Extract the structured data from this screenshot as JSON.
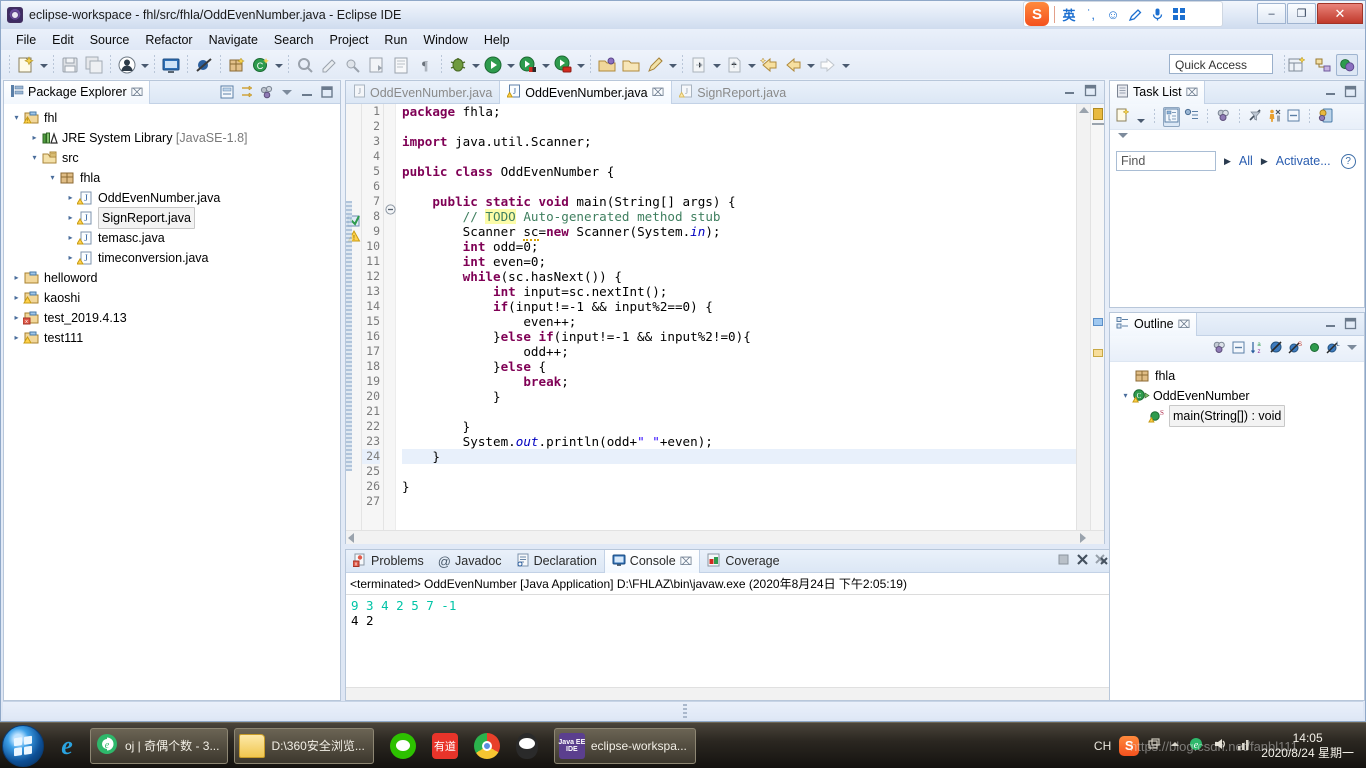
{
  "window": {
    "title": "eclipse-workspace - fhl/src/fhla/OddEvenNumber.java - Eclipse IDE",
    "minimize_label": "–",
    "maximize_label": "❐",
    "close_label": "✕"
  },
  "ime": {
    "logo_label": "S",
    "mode_label": "英",
    "punct_label": "˙,",
    "emoji_label": "☺",
    "pen_label": "✎",
    "mic_label": "ᵔ",
    "apps_label": "apps"
  },
  "menubar": {
    "items": [
      "File",
      "Edit",
      "Source",
      "Refactor",
      "Navigate",
      "Search",
      "Project",
      "Run",
      "Window",
      "Help"
    ]
  },
  "toolbar": {
    "quick_access_placeholder": "Quick Access",
    "quick_access_value": "Quick Access"
  },
  "package_explorer": {
    "title": "Package Explorer",
    "close_label": "⌧",
    "tree": [
      {
        "depth": 0,
        "twist": "▾",
        "icon": "project-warning-icon",
        "label": "fhl",
        "suffix": ""
      },
      {
        "depth": 1,
        "twist": "▸",
        "icon": "jre-library-icon",
        "label": "JRE System Library",
        "suffix": " [JavaSE-1.8]"
      },
      {
        "depth": 1,
        "twist": "▾",
        "icon": "source-folder-icon",
        "label": "src",
        "suffix": ""
      },
      {
        "depth": 2,
        "twist": "▾",
        "icon": "package-icon",
        "label": "fhla",
        "suffix": ""
      },
      {
        "depth": 3,
        "twist": "▸",
        "icon": "java-file-icon",
        "label": "OddEvenNumber.java",
        "suffix": ""
      },
      {
        "depth": 3,
        "twist": "▸",
        "icon": "java-file-icon",
        "label": "SignReport.java",
        "suffix": "",
        "selected": true
      },
      {
        "depth": 3,
        "twist": "▸",
        "icon": "java-file-icon",
        "label": "temasc.java",
        "suffix": ""
      },
      {
        "depth": 3,
        "twist": "▸",
        "icon": "java-file-icon",
        "label": "timeconversion.java",
        "suffix": ""
      },
      {
        "depth": 0,
        "twist": "▸",
        "icon": "project-icon",
        "label": "helloword",
        "suffix": ""
      },
      {
        "depth": 0,
        "twist": "▸",
        "icon": "project-warning-icon",
        "label": "kaoshi",
        "suffix": ""
      },
      {
        "depth": 0,
        "twist": "▸",
        "icon": "project-error-icon",
        "label": "test_2019.4.13",
        "suffix": ""
      },
      {
        "depth": 0,
        "twist": "▸",
        "icon": "project-warning-icon",
        "label": "test111",
        "suffix": ""
      }
    ]
  },
  "editor": {
    "tabs": [
      {
        "label": "OddEvenNumber.java",
        "active": false,
        "closable": false
      },
      {
        "label": "OddEvenNumber.java",
        "active": true,
        "closable": true,
        "close_label": "⌧"
      },
      {
        "label": "SignReport.java",
        "active": false,
        "closable": false
      }
    ],
    "lines": [
      {
        "n": 1,
        "segs": [
          {
            "t": "package",
            "c": "kw"
          },
          {
            "t": " fhla;",
            "c": ""
          }
        ]
      },
      {
        "n": 2,
        "segs": []
      },
      {
        "n": 3,
        "segs": [
          {
            "t": "import",
            "c": "kw"
          },
          {
            "t": " java.util.Scanner;",
            "c": ""
          }
        ]
      },
      {
        "n": 4,
        "segs": []
      },
      {
        "n": 5,
        "segs": [
          {
            "t": "public class",
            "c": "kw"
          },
          {
            "t": " OddEvenNumber {",
            "c": ""
          }
        ]
      },
      {
        "n": 6,
        "segs": []
      },
      {
        "n": 7,
        "segs": [
          {
            "t": "    ",
            "c": ""
          },
          {
            "t": "public static void",
            "c": "kw"
          },
          {
            "t": " main(String[] args) {",
            "c": ""
          }
        ],
        "fold": true
      },
      {
        "n": 8,
        "segs": [
          {
            "t": "        ",
            "c": ""
          },
          {
            "t": "// ",
            "c": "cm"
          },
          {
            "t": "TODO",
            "c": "todo"
          },
          {
            "t": " Auto-generated method stub",
            "c": "cm"
          }
        ],
        "marker": "task"
      },
      {
        "n": 9,
        "segs": [
          {
            "t": "        Scanner ",
            "c": ""
          },
          {
            "t": "sc",
            "c": "warn"
          },
          {
            "t": "=",
            "c": ""
          },
          {
            "t": "new",
            "c": "kw"
          },
          {
            "t": " Scanner(System.",
            "c": ""
          },
          {
            "t": "in",
            "c": "fld"
          },
          {
            "t": ");",
            "c": ""
          }
        ],
        "marker": "warning"
      },
      {
        "n": 10,
        "segs": [
          {
            "t": "        ",
            "c": ""
          },
          {
            "t": "int",
            "c": "kw"
          },
          {
            "t": " odd=0;",
            "c": ""
          }
        ]
      },
      {
        "n": 11,
        "segs": [
          {
            "t": "        ",
            "c": ""
          },
          {
            "t": "int",
            "c": "kw"
          },
          {
            "t": " even=0;",
            "c": ""
          }
        ]
      },
      {
        "n": 12,
        "segs": [
          {
            "t": "        ",
            "c": ""
          },
          {
            "t": "while",
            "c": "kw"
          },
          {
            "t": "(sc.hasNext()) {",
            "c": ""
          }
        ]
      },
      {
        "n": 13,
        "segs": [
          {
            "t": "            ",
            "c": ""
          },
          {
            "t": "int",
            "c": "kw"
          },
          {
            "t": " input=sc.nextInt();",
            "c": ""
          }
        ]
      },
      {
        "n": 14,
        "segs": [
          {
            "t": "            ",
            "c": ""
          },
          {
            "t": "if",
            "c": "kw"
          },
          {
            "t": "(input!=-1 && input%2==0) {",
            "c": ""
          }
        ]
      },
      {
        "n": 15,
        "segs": [
          {
            "t": "                even++;",
            "c": ""
          }
        ]
      },
      {
        "n": 16,
        "segs": [
          {
            "t": "            }",
            "c": ""
          },
          {
            "t": "else if",
            "c": "kw"
          },
          {
            "t": "(input!=-1 && input%2!=0){",
            "c": ""
          }
        ]
      },
      {
        "n": 17,
        "segs": [
          {
            "t": "                odd++;",
            "c": ""
          }
        ]
      },
      {
        "n": 18,
        "segs": [
          {
            "t": "            }",
            "c": ""
          },
          {
            "t": "else",
            "c": "kw"
          },
          {
            "t": " {",
            "c": ""
          }
        ]
      },
      {
        "n": 19,
        "segs": [
          {
            "t": "                ",
            "c": ""
          },
          {
            "t": "break",
            "c": "kw"
          },
          {
            "t": ";",
            "c": ""
          }
        ]
      },
      {
        "n": 20,
        "segs": [
          {
            "t": "            }",
            "c": ""
          }
        ]
      },
      {
        "n": 21,
        "segs": []
      },
      {
        "n": 22,
        "segs": [
          {
            "t": "        }",
            "c": ""
          }
        ]
      },
      {
        "n": 23,
        "segs": [
          {
            "t": "        System.",
            "c": ""
          },
          {
            "t": "out",
            "c": "fld"
          },
          {
            "t": ".println(odd+",
            "c": ""
          },
          {
            "t": "\" \"",
            "c": "str"
          },
          {
            "t": "+even);",
            "c": ""
          }
        ]
      },
      {
        "n": 24,
        "segs": [
          {
            "t": "    }",
            "c": ""
          }
        ],
        "current": true
      },
      {
        "n": 25,
        "segs": []
      },
      {
        "n": 26,
        "segs": [
          {
            "t": "}",
            "c": ""
          }
        ]
      },
      {
        "n": 27,
        "segs": []
      }
    ]
  },
  "console": {
    "tabs": [
      {
        "label": "Problems",
        "icon": "problems-icon",
        "active": false
      },
      {
        "label": "Javadoc",
        "icon": "javadoc-icon",
        "active": false
      },
      {
        "label": "Declaration",
        "icon": "declaration-icon",
        "active": false
      },
      {
        "label": "Console",
        "icon": "console-icon",
        "active": true,
        "close_label": "⌧"
      },
      {
        "label": "Coverage",
        "icon": "coverage-icon",
        "active": false
      }
    ],
    "launch_header": "<terminated> OddEvenNumber [Java Application] D:\\FHLAZ\\bin\\javaw.exe (2020年8月24日 下午2:05:19)",
    "output": [
      {
        "text": "9 3 4 2 5 7 -1",
        "kind": "input"
      },
      {
        "text": "4 2",
        "kind": "stdout"
      }
    ]
  },
  "task_list": {
    "title": "Task List",
    "close_label": "⌧",
    "find_placeholder": "Find",
    "find_value": "Find",
    "all_label": "All",
    "activate_label": "Activate...",
    "help_label": "?"
  },
  "outline": {
    "title": "Outline",
    "close_label": "⌧",
    "items": [
      {
        "depth": 1,
        "twist": "",
        "icon": "package-icon",
        "label": "fhla"
      },
      {
        "depth": 0,
        "twist": "▾",
        "icon": "class-icon",
        "label": "OddEvenNumber"
      },
      {
        "depth": 2,
        "twist": "",
        "icon": "method-static-icon",
        "label": "main(String[]) : void",
        "selected": true
      }
    ]
  },
  "taskbar": {
    "buttons": [
      {
        "label": "oj | 奇偶个数 - 3...",
        "icon": "browser-360-icon"
      },
      {
        "label": "D:\\360安全浏览...",
        "icon": "folder-icon"
      },
      {
        "label": "eclipse-workspa...",
        "icon": "eclipse-icon"
      }
    ],
    "quick_launch": [
      {
        "icon": "wechat-icon"
      },
      {
        "icon": "youdao-icon",
        "label": "有道"
      },
      {
        "icon": "chrome-icon"
      },
      {
        "icon": "qq-icon"
      }
    ],
    "tray": {
      "ime_label": "CH",
      "sogou_label": "S",
      "time": "14:05",
      "date": "2020/8/24 星期一"
    },
    "watermark": "https://blog.csdn.net/fanbl111"
  }
}
